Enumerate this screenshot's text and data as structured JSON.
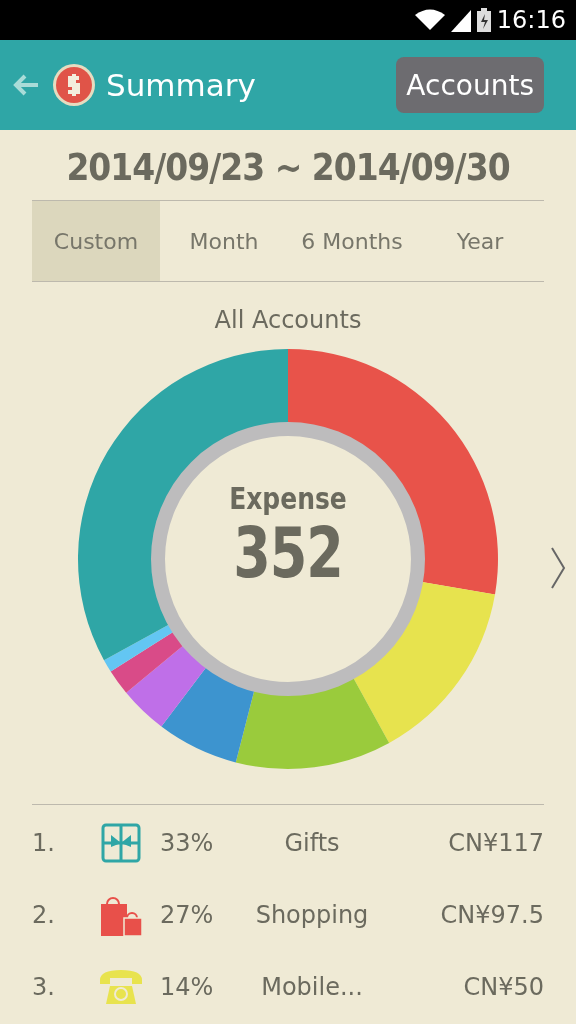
{
  "status_bar": {
    "time": "16:16"
  },
  "header": {
    "title": "Summary",
    "button": "Accounts"
  },
  "date_range": "2014/09/23 ~ 2014/09/30",
  "tabs": [
    {
      "label": "Custom",
      "selected": true
    },
    {
      "label": "Month",
      "selected": false
    },
    {
      "label": "6 Months",
      "selected": false
    },
    {
      "label": "Year",
      "selected": false
    }
  ],
  "chart": {
    "title": "All Accounts",
    "center_label": "Expense",
    "center_value": "352"
  },
  "categories": [
    {
      "rank": "1.",
      "kind": "gift",
      "percent": "33%",
      "name": "Gifts",
      "amount": "CN¥117"
    },
    {
      "rank": "2.",
      "kind": "shopping",
      "percent": "27%",
      "name": "Shopping",
      "amount": "CN¥97.5"
    },
    {
      "rank": "3.",
      "kind": "phone",
      "percent": "14%",
      "name": "Mobile...",
      "amount": "CN¥50"
    }
  ]
}
